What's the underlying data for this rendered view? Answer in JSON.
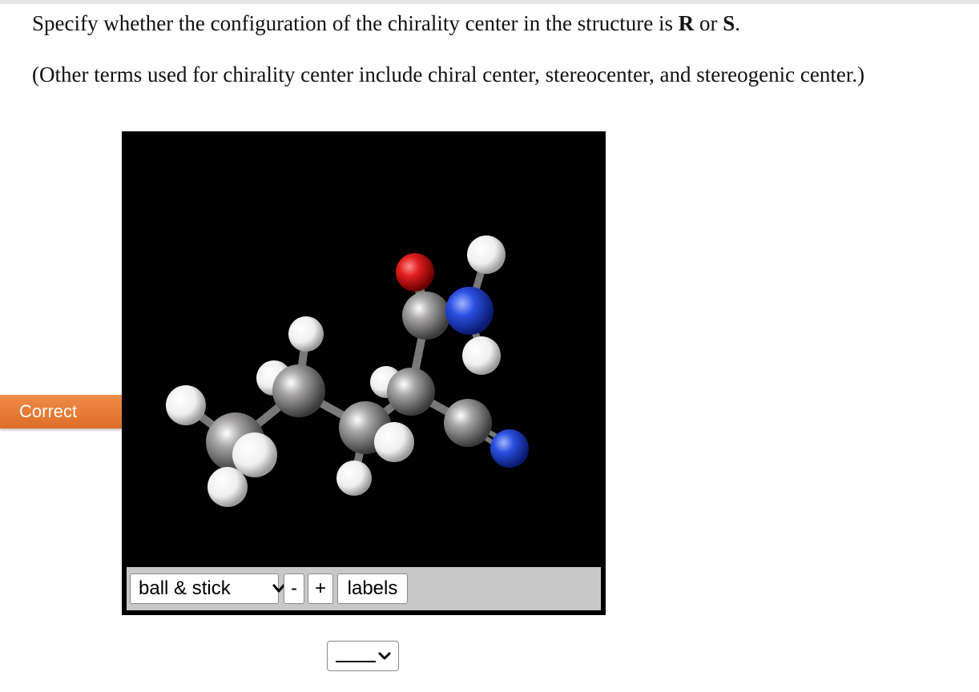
{
  "question": {
    "line1_prefix": "Specify whether the configuration of the chirality center in the structure is ",
    "option_r": "R",
    "line1_or": " or ",
    "option_s": "S",
    "line1_end": ".",
    "line2": "(Other terms used for chirality center include chiral center, stereocenter, and stereogenic center.)"
  },
  "feedback": {
    "label": "Correct"
  },
  "viewer": {
    "render_mode": "ball & stick",
    "zoom_out_label": "-",
    "zoom_in_label": "+",
    "labels_button": "labels",
    "colors": {
      "carbon": "#8c8a8a",
      "hydrogen": "#f2f2f2",
      "oxygen": "#e02020",
      "nitrogen": "#2a4fe0",
      "background": "#000000"
    }
  },
  "answer": {
    "selected": "",
    "icon": "chevron-down-icon"
  }
}
